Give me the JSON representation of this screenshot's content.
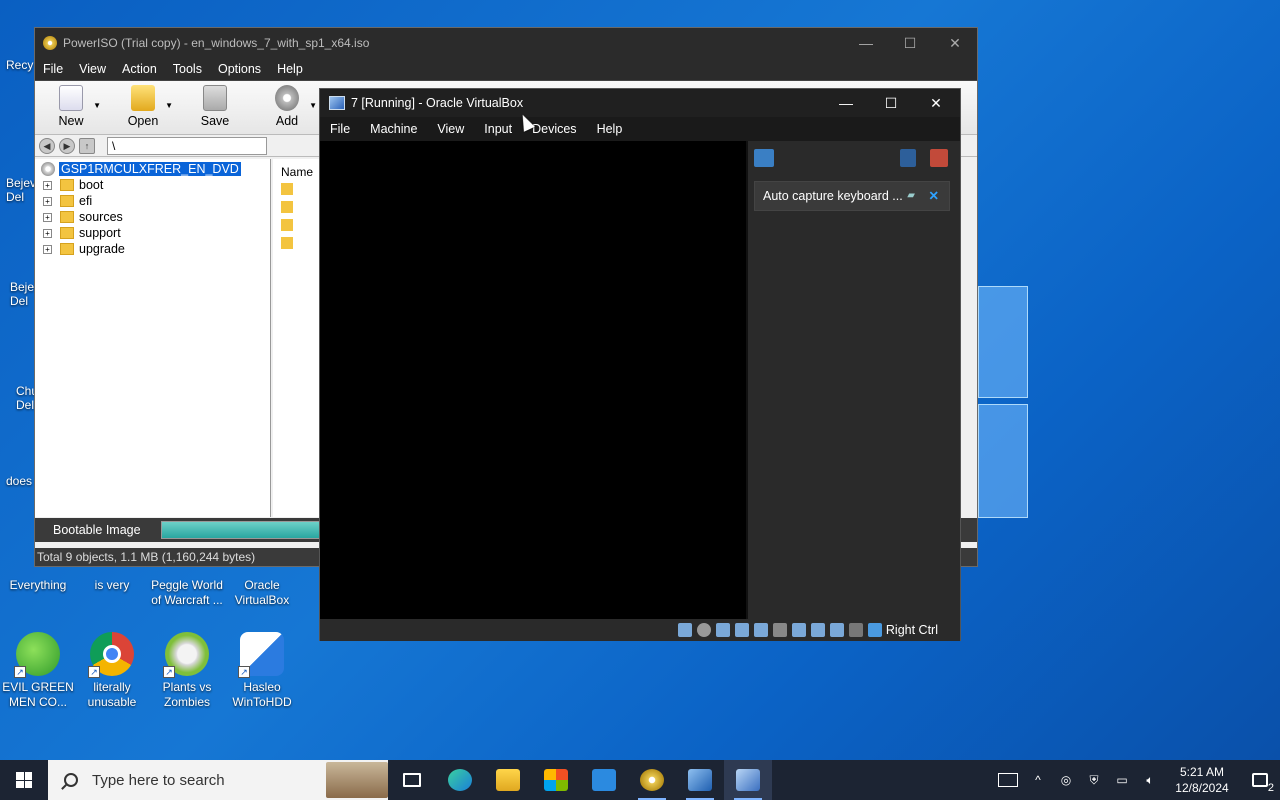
{
  "desktop": {
    "icons": [
      {
        "label": "Recycle Bin",
        "short": "Recy"
      },
      {
        "label": "Bejeweled Deluxe",
        "short": "Bejev\nDel"
      },
      {
        "label": "Bejeweled Deluxe",
        "short": "Beje\nDel"
      },
      {
        "label": "Chuzzle Deluxe",
        "short": "Chu\nDel"
      },
      {
        "label": "doesn't",
        "short": "does"
      },
      {
        "label": "Everything"
      },
      {
        "label": "is very"
      },
      {
        "label": "Peggle World of Warcraft ..."
      },
      {
        "label": "Oracle VirtualBox"
      },
      {
        "label": "EVIL GREEN MEN CO..."
      },
      {
        "label": "literally unusable"
      },
      {
        "label": "Plants vs Zombies"
      },
      {
        "label": "Hasleo WinToHDD"
      }
    ]
  },
  "poweriso": {
    "title": "PowerISO (Trial copy) - en_windows_7_with_sp1_x64.iso",
    "menu": [
      "File",
      "View",
      "Action",
      "Tools",
      "Options",
      "Help"
    ],
    "toolbar": [
      "New",
      "Open",
      "Save",
      "Add"
    ],
    "address": "\\",
    "tree": {
      "root": "GSP1RMCULXFRER_EN_DVD",
      "folders": [
        "boot",
        "efi",
        "sources",
        "support",
        "upgrade"
      ]
    },
    "column_header": "Name",
    "bootable_label": "Bootable Image",
    "status": "Total 9 objects, 1.1 MB (1,160,244 bytes)"
  },
  "virtualbox": {
    "title": "7 [Running] - Oracle VirtualBox",
    "menu": [
      "File",
      "Machine",
      "View",
      "Input",
      "Devices",
      "Help"
    ],
    "notification": "Auto capture keyboard ...",
    "host_key": "Right Ctrl"
  },
  "taskbar": {
    "search_placeholder": "Type here to search",
    "time": "5:21 AM",
    "date": "12/8/2024",
    "notification_count": "2"
  }
}
